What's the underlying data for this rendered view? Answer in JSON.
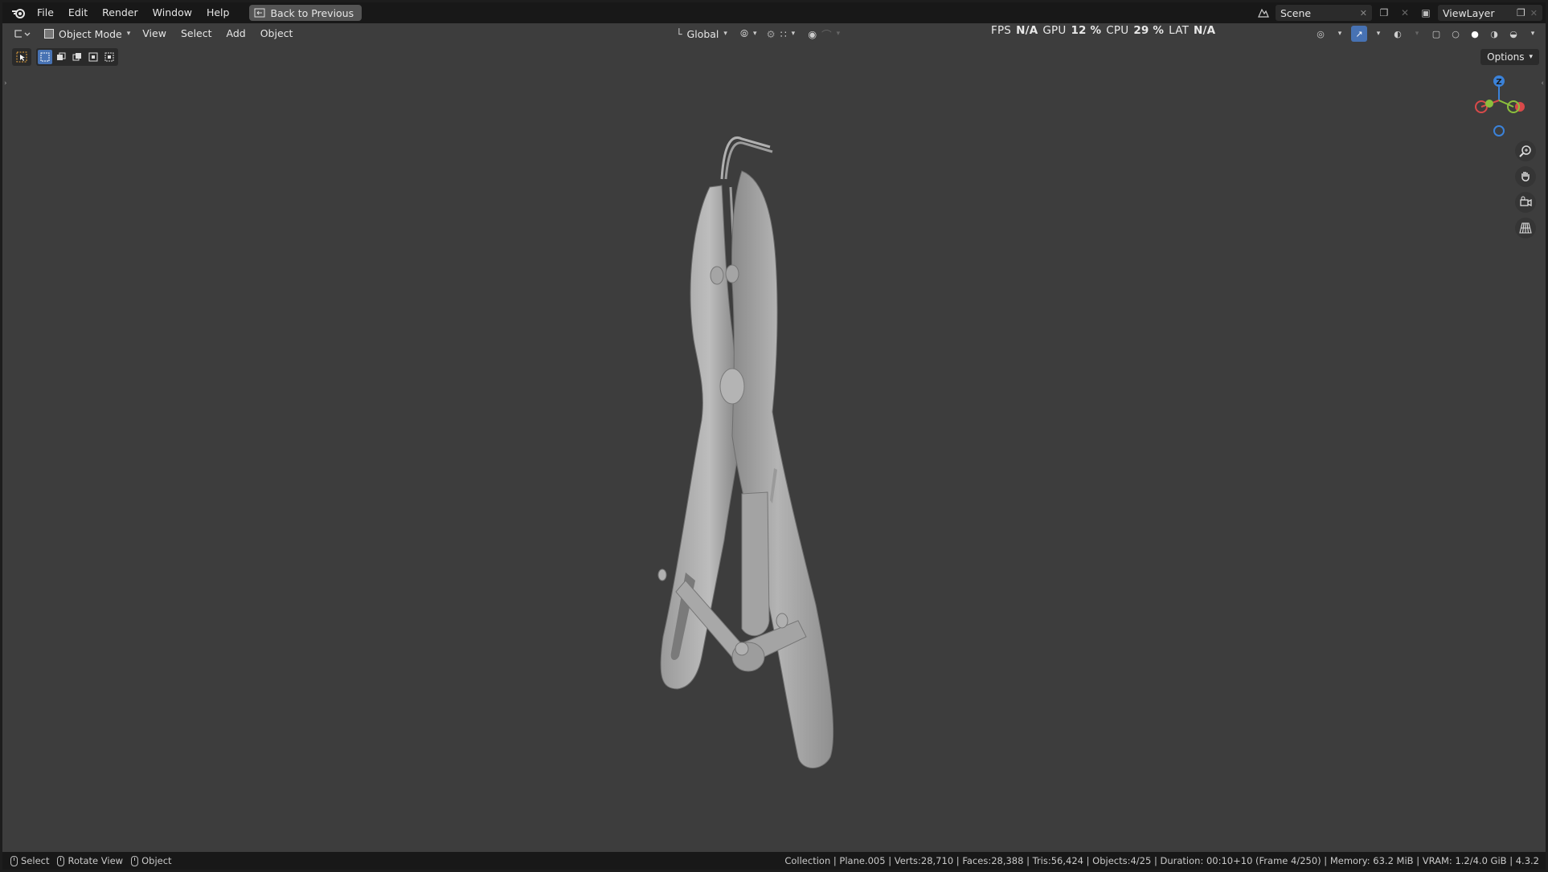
{
  "menu": {
    "items": [
      "File",
      "Edit",
      "Render",
      "Window",
      "Help"
    ],
    "back_button": "Back to Previous"
  },
  "top_right": {
    "scene": "Scene",
    "view_layer": "ViewLayer"
  },
  "viewport_header": {
    "mode": "Object Mode",
    "menus": [
      "View",
      "Select",
      "Add",
      "Object"
    ],
    "transform_orientation": "Global"
  },
  "stats": {
    "fps_label": "FPS",
    "fps_value": "N/A",
    "gpu_label": "GPU",
    "gpu_value": "12 %",
    "cpu_label": "CPU",
    "cpu_value": "29 %",
    "lat_label": "LAT",
    "lat_value": "N/A"
  },
  "options_label": "Options",
  "gizmo": {
    "z_label": "Z"
  },
  "status_bar": {
    "hints": [
      "Select",
      "Rotate View",
      "Object"
    ],
    "info": "Collection | Plane.005 | Verts:28,710 | Faces:28,388 | Tris:56,424 | Objects:4/25 | Duration: 00:10+10 (Frame 4/250) | Memory: 63.2 MiB | VRAM: 1.2/4.0 GiB | 4.3.2"
  },
  "colors": {
    "viewport_bg": "#3d3d3d",
    "header_bg": "#181818",
    "accent": "#4772b3",
    "axis_x": "#d94a4a",
    "axis_y": "#8bbf3c",
    "axis_z": "#3b82d9",
    "model": "#a9a9a9"
  }
}
